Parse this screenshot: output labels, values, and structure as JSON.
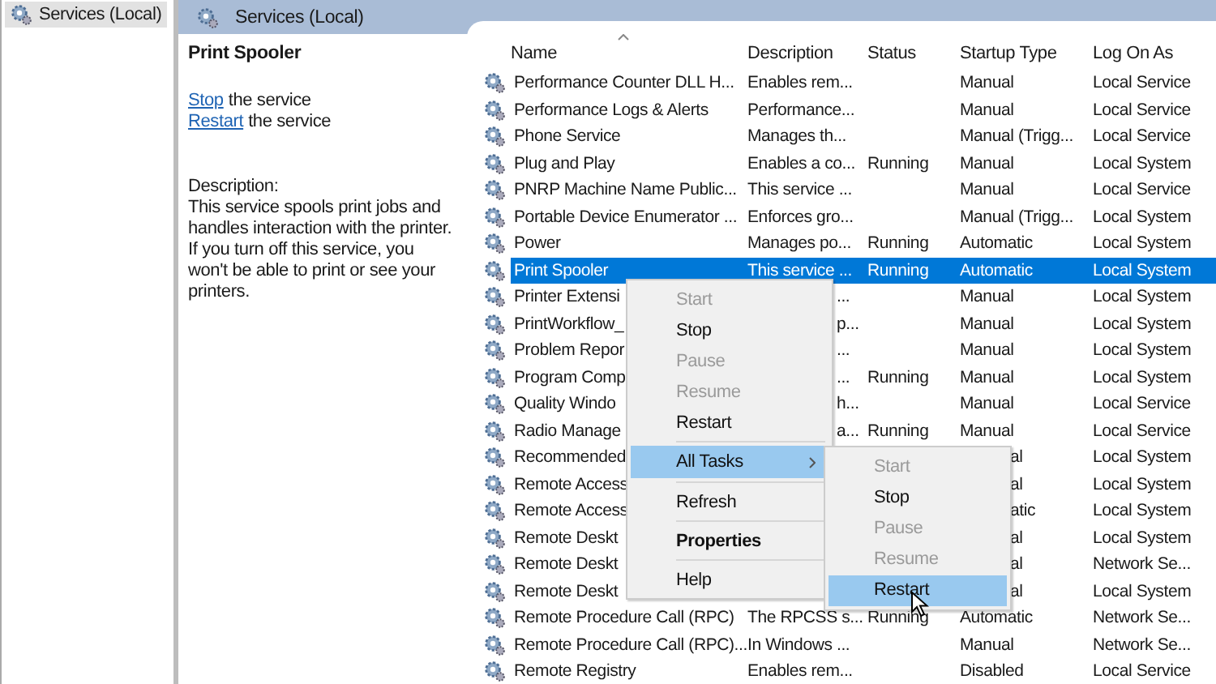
{
  "tree": {
    "items": [
      {
        "label": "Services (Local)",
        "selected": true
      }
    ]
  },
  "header": {
    "title": "Services (Local)"
  },
  "details": {
    "title": "Print Spooler",
    "actions": [
      {
        "link": "Stop",
        "text": "the service"
      },
      {
        "link": "Restart",
        "text": "the service"
      }
    ],
    "description_label": "Description:",
    "description": "This service spools print jobs and handles interaction with the printer. If you turn off this service, you won't be able to print or see your printers."
  },
  "table": {
    "columns": [
      "Name",
      "Description",
      "Status",
      "Startup Type",
      "Log On As"
    ],
    "rows": [
      {
        "name": "Performance Counter DLL H...",
        "description": "Enables rem...",
        "status": "",
        "startup_type": "Manual",
        "log_on_as": "Local Service",
        "selected": false
      },
      {
        "name": "Performance Logs & Alerts",
        "description": "Performance...",
        "status": "",
        "startup_type": "Manual",
        "log_on_as": "Local Service",
        "selected": false
      },
      {
        "name": "Phone Service",
        "description": "Manages th...",
        "status": "",
        "startup_type": "Manual (Trigg...",
        "log_on_as": "Local Service",
        "selected": false
      },
      {
        "name": "Plug and Play",
        "description": "Enables a co...",
        "status": "Running",
        "startup_type": "Manual",
        "log_on_as": "Local System",
        "selected": false
      },
      {
        "name": "PNRP Machine Name Public...",
        "description": "This service ...",
        "status": "",
        "startup_type": "Manual",
        "log_on_as": "Local Service",
        "selected": false
      },
      {
        "name": "Portable Device Enumerator ...",
        "description": "Enforces gro...",
        "status": "",
        "startup_type": "Manual (Trigg...",
        "log_on_as": "Local System",
        "selected": false
      },
      {
        "name": "Power",
        "description": "Manages po...",
        "status": "Running",
        "startup_type": "Automatic",
        "log_on_as": "Local System",
        "selected": false
      },
      {
        "name": "Print Spooler",
        "description": "This service ...",
        "status": "Running",
        "startup_type": "Automatic",
        "log_on_as": "Local System",
        "selected": true
      },
      {
        "name": "Printer Extensi",
        "description": "...",
        "description_cut": true,
        "status": "",
        "startup_type": "Manual",
        "log_on_as": "Local System",
        "selected": false
      },
      {
        "name": "PrintWorkflow_",
        "description": "p...",
        "description_cut": true,
        "status": "",
        "startup_type": "Manual",
        "log_on_as": "Local System",
        "selected": false
      },
      {
        "name": "Problem Repor",
        "description": "...",
        "description_cut": true,
        "status": "",
        "startup_type": "Manual",
        "log_on_as": "Local System",
        "selected": false
      },
      {
        "name": "Program Comp",
        "description": "...",
        "description_cut": true,
        "status": "Running",
        "startup_type": "Manual",
        "log_on_as": "Local System",
        "selected": false
      },
      {
        "name": "Quality Windo",
        "description": "h...",
        "description_cut": true,
        "status": "",
        "startup_type": "Manual",
        "log_on_as": "Local Service",
        "selected": false
      },
      {
        "name": "Radio Manage",
        "description": "a...",
        "description_cut": true,
        "status": "Running",
        "startup_type": "Manual",
        "log_on_as": "Local Service",
        "selected": false
      },
      {
        "name": "Recommended",
        "description": "",
        "status": "",
        "startup_type": "al",
        "startup_cut": true,
        "log_on_as": "Local System",
        "selected": false
      },
      {
        "name": "Remote Access",
        "description": "",
        "status": "",
        "startup_type": "al",
        "startup_cut": true,
        "log_on_as": "Local System",
        "selected": false
      },
      {
        "name": "Remote Access",
        "description": "",
        "status": "",
        "startup_type": "atic",
        "startup_cut": true,
        "log_on_as": "Local System",
        "selected": false
      },
      {
        "name": "Remote Deskt",
        "description": "",
        "status": "",
        "startup_type": "al",
        "startup_cut": true,
        "log_on_as": "Local System",
        "selected": false
      },
      {
        "name": "Remote Deskt",
        "description": "",
        "status": "",
        "startup_type": "al",
        "startup_cut": true,
        "log_on_as": "Network Se...",
        "selected": false
      },
      {
        "name": "Remote Deskt",
        "description": "",
        "status": "",
        "startup_type": "al",
        "startup_cut": true,
        "log_on_as": "Local System",
        "selected": false
      },
      {
        "name": "Remote Procedure Call (RPC)",
        "description": "The RPCSS s...",
        "status": "Running",
        "startup_type": "Automatic",
        "log_on_as": "Network Se...",
        "selected": false
      },
      {
        "name": "Remote Procedure Call (RPC)...",
        "description": "In Windows ...",
        "status": "",
        "startup_type": "Manual",
        "log_on_as": "Network Se...",
        "selected": false
      },
      {
        "name": "Remote Registry",
        "description": "Enables rem...",
        "status": "",
        "startup_type": "Disabled",
        "log_on_as": "Local Service",
        "selected": false
      }
    ]
  },
  "context_menu": {
    "items": [
      {
        "kind": "item",
        "label": "Start",
        "disabled": true,
        "selected": false
      },
      {
        "kind": "item",
        "label": "Stop",
        "disabled": false,
        "selected": false
      },
      {
        "kind": "item",
        "label": "Pause",
        "disabled": true,
        "selected": false
      },
      {
        "kind": "item",
        "label": "Resume",
        "disabled": true,
        "selected": false
      },
      {
        "kind": "item",
        "label": "Restart",
        "disabled": false,
        "selected": false
      },
      {
        "kind": "separator"
      },
      {
        "kind": "submenu",
        "label": "All Tasks",
        "disabled": false,
        "selected": true
      },
      {
        "kind": "separator"
      },
      {
        "kind": "item",
        "label": "Refresh",
        "disabled": false,
        "selected": false
      },
      {
        "kind": "separator"
      },
      {
        "kind": "bold",
        "label": "Properties",
        "disabled": false,
        "selected": false
      },
      {
        "kind": "separator"
      },
      {
        "kind": "item",
        "label": "Help",
        "disabled": false,
        "selected": false
      }
    ]
  },
  "submenu": {
    "items": [
      {
        "label": "Start",
        "disabled": true,
        "selected": false
      },
      {
        "label": "Stop",
        "disabled": false,
        "selected": false
      },
      {
        "label": "Pause",
        "disabled": true,
        "selected": false
      },
      {
        "label": "Resume",
        "disabled": true,
        "selected": false
      },
      {
        "label": "Restart",
        "disabled": false,
        "selected": true
      }
    ]
  }
}
